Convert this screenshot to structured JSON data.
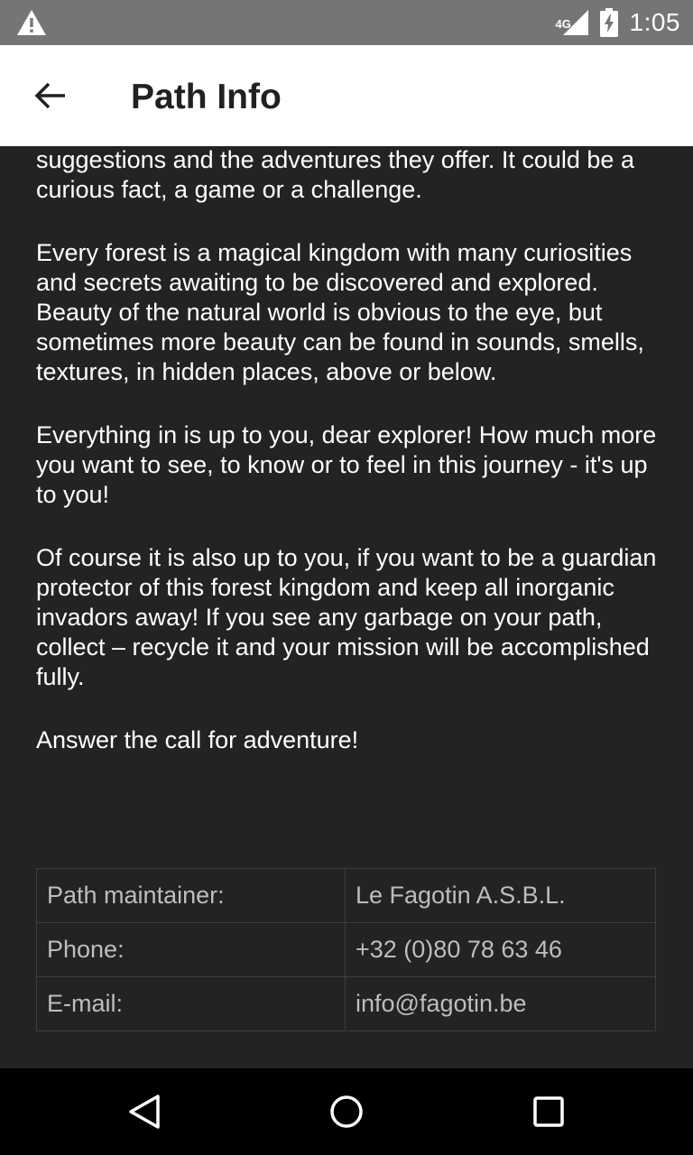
{
  "status_bar": {
    "network": "4G",
    "time": "1:05",
    "icons": [
      "warning-icon",
      "signal-icon",
      "battery-charging-icon"
    ]
  },
  "app_bar": {
    "title": "Path Info",
    "back_icon": "arrow-left-icon"
  },
  "content": {
    "paragraphs": [
      "stop for a while, take a moment to explore the suggestions and the adventures they offer. It could be a curious fact, a game or a challenge.",
      "Every forest is a magical kingdom with many curiosities and secrets awaiting to be discovered and explored. Beauty of the natural world is obvious to the eye, but sometimes more beauty can be found in sounds, smells, textures, in hidden places, above or below.",
      "Everything in is up to you, dear explorer! How much more you want to see, to know or to feel in this journey - it's up to you!",
      "Of course it is also up to you, if you want to be a guardian protector of this forest kingdom and keep all inorganic invadors away! If you see any garbage on your path, collect – recycle it and your mission will be accomplished fully.",
      "Answer the call for adventure!"
    ],
    "info_table": [
      {
        "label": "Path maintainer:",
        "value": "Le Fagotin A.S.B.L."
      },
      {
        "label": "Phone:",
        "value": "+32 (0)80 78 63 46"
      },
      {
        "label": "E-mail:",
        "value": "info@fagotin.be"
      }
    ]
  },
  "nav_bar": {
    "icons": [
      "back-triangle-icon",
      "home-circle-icon",
      "recents-square-icon"
    ]
  },
  "colors": {
    "status_bar_bg": "#757575",
    "app_bar_bg": "#ffffff",
    "content_bg": "#232323",
    "nav_bar_bg": "#000000",
    "body_text": "#ffffff",
    "table_text": "#bdbdbd"
  }
}
